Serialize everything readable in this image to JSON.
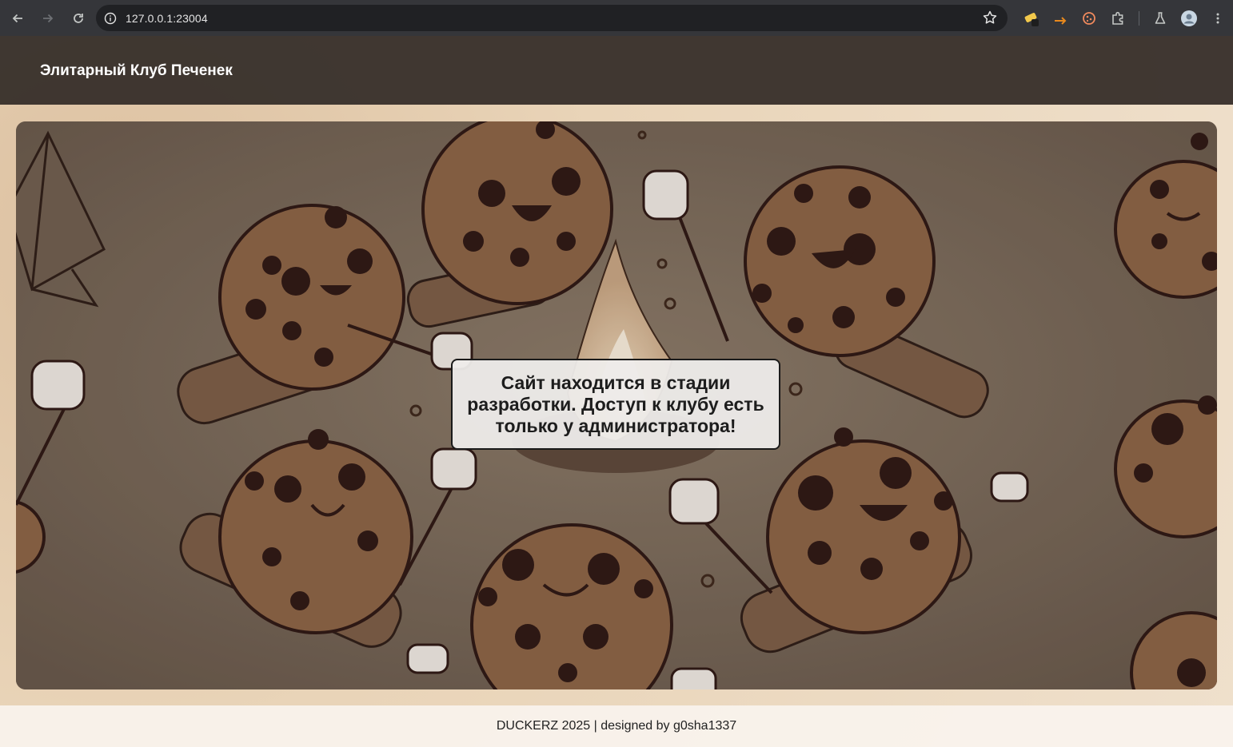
{
  "browser": {
    "url": "127.0.0.1:23004",
    "icons": [
      "back-arrow-icon",
      "forward-arrow-icon",
      "reload-icon",
      "site-info-icon",
      "bookmark-star-icon",
      "extension-pencil-icon",
      "extension-arrow-icon",
      "extension-cookie-icon",
      "extensions-puzzle-icon",
      "labs-flask-icon",
      "profile-avatar-icon",
      "menu-kebab-icon"
    ]
  },
  "header": {
    "title": "Элитарный Клуб Печенек"
  },
  "hero": {
    "notice": "Сайт находится в стадии разработки. Доступ к клубу есть только у администратора!"
  },
  "footer": {
    "text": "DUCKERZ 2025 | designed by g0sha1337"
  },
  "colors": {
    "chrome_bg": "#35363a",
    "omnibox_bg": "#202124",
    "header_bg": "#3a322c",
    "cookie": "#8a6244",
    "chip": "#2a1410",
    "accent_arrow": "#e8891d"
  }
}
